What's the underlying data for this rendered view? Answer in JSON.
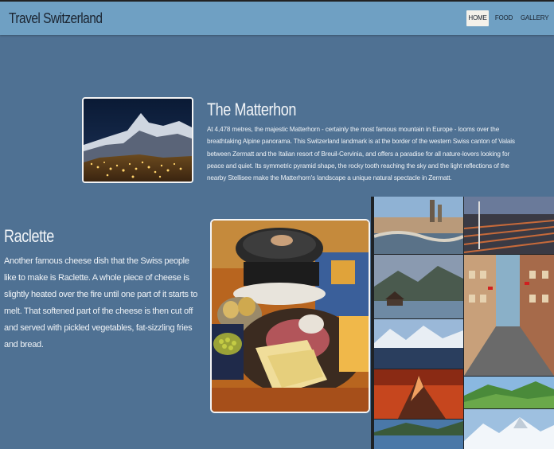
{
  "brand": "Travel Switzerland",
  "nav": {
    "home": "HOME",
    "food": "FOOD",
    "gallery": "GALLERY",
    "active": "HOME"
  },
  "colors": {
    "background": "#4f7193",
    "navbar": "#6fa0c3",
    "active_tab": "#f4f1ea",
    "text_light": "#eef2f6"
  },
  "matterhorn": {
    "title": "The Matterhon",
    "text": "At 4,478 metres, the majestic Matterhorn - certainly the most famous mountain in Europe - looms over the breathtaking Alpine panorama. This Switzerland landmark is at the border of the western Swiss canton of Valais between Zermatt and the Italian resort of Breuil-Cervinia, and offers a paradise for all nature-lovers looking for peace and quiet. Its symmetric pyramid shape, the rocky tooth reaching the sky and the light reflections of the nearby Stellisee make the Matterhorn's landscape a unique natural spectacle in Zermatt."
  },
  "raclette": {
    "title": "Raclette",
    "text": "Another famous cheese dish that the Swiss people like to make is Raclette. A whole piece of cheese is slightly heated over the fire until one part of it starts to melt. That softened part of the cheese is then cut off and served with pickled vegetables, fat-sizzling fries and bread."
  },
  "gallery_photos": [
    "zurich-river-photo",
    "zurich-rail-photo",
    "alpine-lake-chapel-photo",
    "old-town-street-photo",
    "mountain-lake-photo",
    "matterhorn-sunset-photo",
    "green-valley-photo",
    "blue-lake-photo",
    "snowy-peaks-photo"
  ]
}
